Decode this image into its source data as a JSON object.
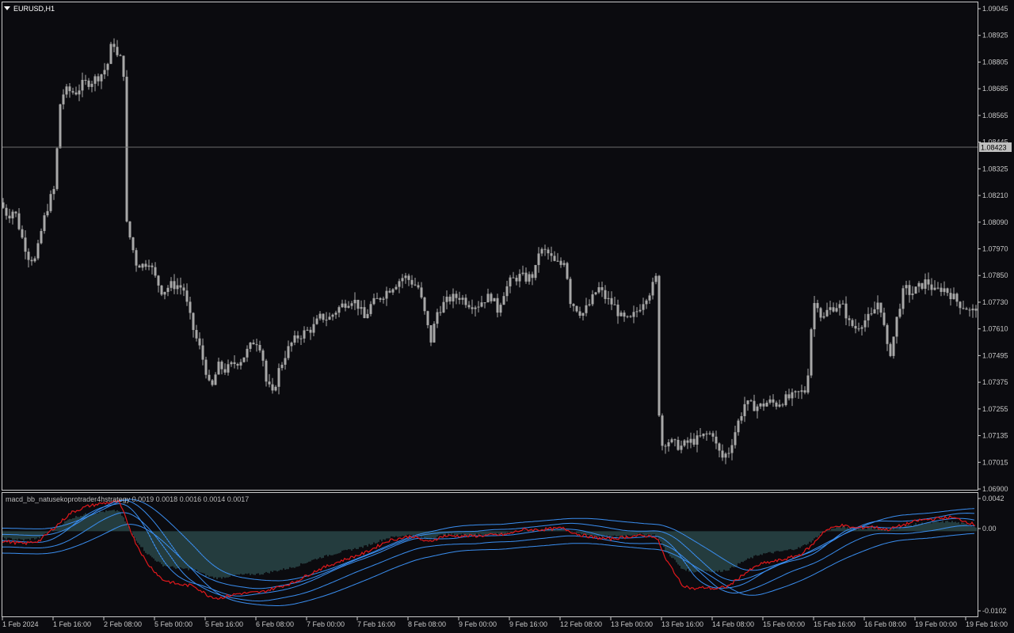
{
  "symbol_label": "EURUSD,H1",
  "current_price": "1.08423",
  "indicator_label": "macd_bb_natusekoprotrader4hstrategy 0.0019 0.0018 0.0016 0.0014 0.0017",
  "colors": {
    "background": "#0b0b0f",
    "candle": "#a8a8a8",
    "frame": "#c8c8c8",
    "macd_red": "#e0181c",
    "bands_blue": "#3a8ef0",
    "histogram": "#3d6e6e"
  },
  "price_axis": {
    "min": 1.069,
    "max": 1.09045,
    "ticks": [
      "1.09045",
      "1.08925",
      "1.08805",
      "1.08685",
      "1.08565",
      "1.08445",
      "1.08325",
      "1.08210",
      "1.08090",
      "1.07970",
      "1.07850",
      "1.07730",
      "1.07610",
      "1.07495",
      "1.07375",
      "1.07255",
      "1.07135",
      "1.07015",
      "1.06900"
    ]
  },
  "indicator_axis": {
    "ticks": [
      "0.0042",
      "0.00",
      "-0.0102"
    ]
  },
  "time_axis": {
    "labels": [
      "1 Feb 2024",
      "1 Feb 16:00",
      "2 Feb 08:00",
      "5 Feb 00:00",
      "5 Feb 16:00",
      "6 Feb 08:00",
      "7 Feb 00:00",
      "7 Feb 16:00",
      "8 Feb 08:00",
      "9 Feb 00:00",
      "9 Feb 16:00",
      "12 Feb 08:00",
      "13 Feb 00:00",
      "13 Feb 16:00",
      "14 Feb 08:00",
      "15 Feb 00:00",
      "15 Feb 16:00",
      "16 Feb 08:00",
      "19 Feb 00:00",
      "19 Feb 16:00"
    ]
  },
  "chart_data": {
    "type": "candlestick",
    "symbol": "EURUSD",
    "timeframe": "H1",
    "price_path_approx": [
      [
        0,
        1.0818
      ],
      [
        10,
        1.0812
      ],
      [
        18,
        1.0815
      ],
      [
        28,
        1.0802
      ],
      [
        36,
        1.0794
      ],
      [
        45,
        1.0792
      ],
      [
        52,
        1.0805
      ],
      [
        58,
        1.0814
      ],
      [
        66,
        1.0822
      ],
      [
        70,
        1.0825
      ],
      [
        74,
        1.0858
      ],
      [
        78,
        1.0866
      ],
      [
        85,
        1.0868
      ],
      [
        95,
        1.0867
      ],
      [
        105,
        1.0871
      ],
      [
        115,
        1.0872
      ],
      [
        123,
        1.0874
      ],
      [
        130,
        1.0876
      ],
      [
        136,
        1.088
      ],
      [
        140,
        1.0887
      ],
      [
        144,
        1.0889
      ],
      [
        148,
        1.0883
      ],
      [
        152,
        1.0882
      ],
      [
        156,
        1.0876
      ],
      [
        158,
        1.0858
      ],
      [
        160,
        1.0808
      ],
      [
        165,
        1.0801
      ],
      [
        172,
        1.0791
      ],
      [
        180,
        1.079
      ],
      [
        188,
        1.0792
      ],
      [
        195,
        1.0785
      ],
      [
        205,
        1.0778
      ],
      [
        215,
        1.0781
      ],
      [
        225,
        1.0781
      ],
      [
        232,
        1.0779
      ],
      [
        238,
        1.0769
      ],
      [
        245,
        1.076
      ],
      [
        252,
        1.0753
      ],
      [
        260,
        1.0743
      ],
      [
        266,
        1.0733
      ],
      [
        275,
        1.0745
      ],
      [
        285,
        1.0743
      ],
      [
        295,
        1.0746
      ],
      [
        305,
        1.0748
      ],
      [
        315,
        1.0753
      ],
      [
        322,
        1.0757
      ],
      [
        330,
        1.0753
      ],
      [
        336,
        1.0738
      ],
      [
        344,
        1.0732
      ],
      [
        352,
        1.0743
      ],
      [
        360,
        1.075
      ],
      [
        368,
        1.0755
      ],
      [
        376,
        1.0758
      ],
      [
        385,
        1.076
      ],
      [
        395,
        1.0762
      ],
      [
        405,
        1.0767
      ],
      [
        415,
        1.0766
      ],
      [
        425,
        1.077
      ],
      [
        435,
        1.0773
      ],
      [
        445,
        1.0775
      ],
      [
        452,
        1.0772
      ],
      [
        460,
        1.0766
      ],
      [
        468,
        1.0772
      ],
      [
        478,
        1.0775
      ],
      [
        490,
        1.0779
      ],
      [
        500,
        1.0782
      ],
      [
        510,
        1.0785
      ],
      [
        518,
        1.0783
      ],
      [
        528,
        1.078
      ],
      [
        535,
        1.077
      ],
      [
        540,
        1.0762
      ],
      [
        545,
        1.0755
      ],
      [
        550,
        1.0768
      ],
      [
        558,
        1.0772
      ],
      [
        568,
        1.0775
      ],
      [
        580,
        1.0776
      ],
      [
        592,
        1.0773
      ],
      [
        602,
        1.0772
      ],
      [
        612,
        1.0775
      ],
      [
        620,
        1.0776
      ],
      [
        628,
        1.077
      ],
      [
        636,
        1.0778
      ],
      [
        645,
        1.0783
      ],
      [
        655,
        1.0785
      ],
      [
        665,
        1.0784
      ],
      [
        675,
        1.0786
      ],
      [
        680,
        1.0796
      ],
      [
        690,
        1.0796
      ],
      [
        700,
        1.0791
      ],
      [
        710,
        1.079
      ],
      [
        714,
        1.0795
      ],
      [
        718,
        1.0775
      ],
      [
        725,
        1.0772
      ],
      [
        735,
        1.0768
      ],
      [
        745,
        1.0773
      ],
      [
        755,
        1.078
      ],
      [
        765,
        1.0775
      ],
      [
        775,
        1.0772
      ],
      [
        785,
        1.0766
      ],
      [
        795,
        1.0765
      ],
      [
        805,
        1.077
      ],
      [
        815,
        1.0776
      ],
      [
        822,
        1.0779
      ],
      [
        828,
        1.0784
      ],
      [
        830,
        1.074
      ],
      [
        834,
        1.0709
      ],
      [
        842,
        1.0712
      ],
      [
        850,
        1.071
      ],
      [
        860,
        1.0709
      ],
      [
        870,
        1.0711
      ],
      [
        880,
        1.0712
      ],
      [
        890,
        1.0714
      ],
      [
        900,
        1.0715
      ],
      [
        905,
        1.0708
      ],
      [
        912,
        1.0704
      ],
      [
        920,
        1.0707
      ],
      [
        930,
        1.0718
      ],
      [
        940,
        1.0728
      ],
      [
        950,
        1.0727
      ],
      [
        960,
        1.0727
      ],
      [
        970,
        1.0729
      ],
      [
        980,
        1.0728
      ],
      [
        990,
        1.073
      ],
      [
        1000,
        1.0731
      ],
      [
        1010,
        1.0733
      ],
      [
        1018,
        1.0734
      ],
      [
        1022,
        1.0751
      ],
      [
        1026,
        1.0773
      ],
      [
        1032,
        1.0773
      ],
      [
        1038,
        1.0765
      ],
      [
        1045,
        1.077
      ],
      [
        1055,
        1.0772
      ],
      [
        1065,
        1.0771
      ],
      [
        1072,
        1.0764
      ],
      [
        1080,
        1.0762
      ],
      [
        1090,
        1.0765
      ],
      [
        1100,
        1.0767
      ],
      [
        1110,
        1.0775
      ],
      [
        1116,
        1.0762
      ],
      [
        1122,
        1.0748
      ],
      [
        1128,
        1.0758
      ],
      [
        1134,
        1.077
      ],
      [
        1142,
        1.078
      ],
      [
        1150,
        1.0777
      ],
      [
        1160,
        1.078
      ],
      [
        1170,
        1.0783
      ],
      [
        1180,
        1.0778
      ],
      [
        1190,
        1.078
      ],
      [
        1200,
        1.0777
      ],
      [
        1210,
        1.0773
      ],
      [
        1220,
        1.0771
      ],
      [
        1226,
        1.0768
      ],
      [
        1233,
        1.0772
      ]
    ],
    "macd_path_approx": [
      [
        0,
        -0.0012
      ],
      [
        30,
        -0.0016
      ],
      [
        50,
        -0.0012
      ],
      [
        70,
        0.0006
      ],
      [
        90,
        0.0024
      ],
      [
        110,
        0.0032
      ],
      [
        130,
        0.0036
      ],
      [
        150,
        0.0038
      ],
      [
        160,
        0.0014
      ],
      [
        170,
        -0.0012
      ],
      [
        185,
        -0.004
      ],
      [
        205,
        -0.0062
      ],
      [
        225,
        -0.0068
      ],
      [
        245,
        -0.007
      ],
      [
        262,
        -0.0082
      ],
      [
        275,
        -0.0086
      ],
      [
        300,
        -0.008
      ],
      [
        330,
        -0.0078
      ],
      [
        350,
        -0.0072
      ],
      [
        370,
        -0.0066
      ],
      [
        400,
        -0.005
      ],
      [
        430,
        -0.0038
      ],
      [
        460,
        -0.0028
      ],
      [
        490,
        -0.0012
      ],
      [
        520,
        -0.0006
      ],
      [
        540,
        -0.0014
      ],
      [
        560,
        -0.0006
      ],
      [
        600,
        -0.0006
      ],
      [
        640,
        -0.0004
      ],
      [
        660,
        0.0002
      ],
      [
        680,
        0.0002
      ],
      [
        710,
        0.0004
      ],
      [
        730,
        -0.0004
      ],
      [
        750,
        -0.0008
      ],
      [
        770,
        -0.001
      ],
      [
        800,
        -0.0006
      ],
      [
        825,
        -0.0006
      ],
      [
        832,
        -0.0014
      ],
      [
        840,
        -0.0036
      ],
      [
        850,
        -0.005
      ],
      [
        860,
        -0.0068
      ],
      [
        875,
        -0.0074
      ],
      [
        890,
        -0.0072
      ],
      [
        905,
        -0.0074
      ],
      [
        920,
        -0.007
      ],
      [
        940,
        -0.0054
      ],
      [
        960,
        -0.0042
      ],
      [
        990,
        -0.0036
      ],
      [
        1010,
        -0.003
      ],
      [
        1025,
        -0.0018
      ],
      [
        1040,
        0.0
      ],
      [
        1060,
        0.0008
      ],
      [
        1080,
        0.0004
      ],
      [
        1100,
        0.0006
      ],
      [
        1120,
        0.0002
      ],
      [
        1140,
        0.0008
      ],
      [
        1160,
        0.0014
      ],
      [
        1180,
        0.0016
      ],
      [
        1200,
        0.0018
      ],
      [
        1215,
        0.0014
      ],
      [
        1232,
        0.0008
      ]
    ],
    "bands_note": "blue bollinger bands around MACD"
  }
}
